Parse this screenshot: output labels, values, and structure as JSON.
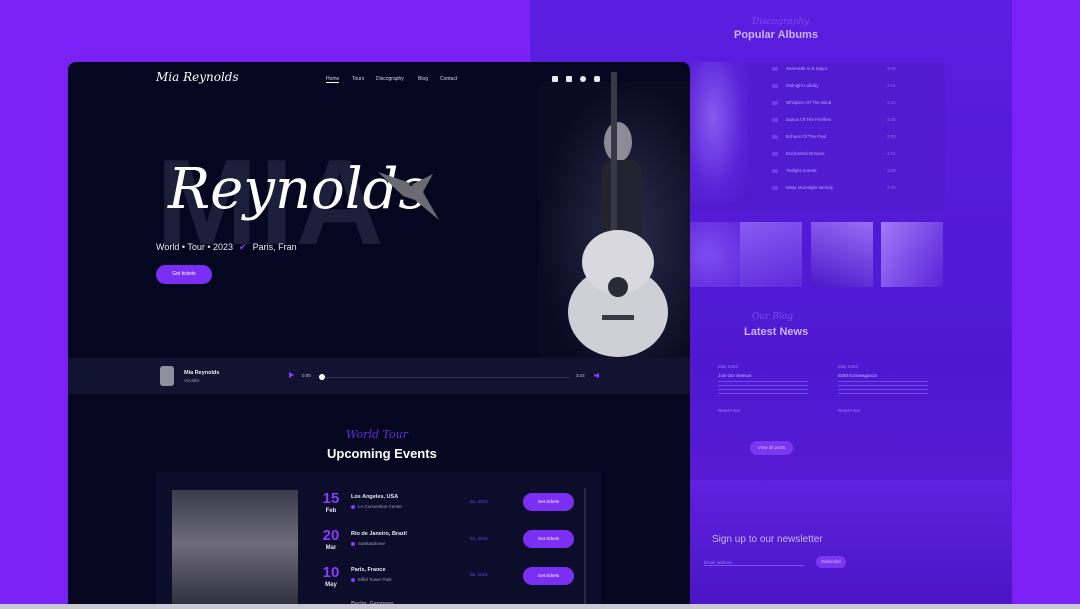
{
  "right": {
    "albums_kicker": "Discography",
    "albums_title": "Popular Albums",
    "tracks": [
      {
        "title": "Serenade In E Major",
        "time": "3:10"
      },
      {
        "title": "Midnight Lullaby",
        "time": "3:21"
      },
      {
        "title": "Whispers Of The Wind",
        "time": "3:14"
      },
      {
        "title": "Dance Of The Fireflies",
        "time": "3:40"
      },
      {
        "title": "Echoes Of The Past",
        "time": "3:05"
      },
      {
        "title": "Enchanted Dreams",
        "time": "4:01"
      },
      {
        "title": "Twilight Sonata",
        "time": "3:29"
      },
      {
        "title": "Misty Moonlight Melody",
        "time": "3:55"
      }
    ],
    "news_kicker": "Our Blog",
    "news_title": "Latest News",
    "news": [
      {
        "date": "May 2023",
        "title": "Join Our Season",
        "link": "Read more"
      },
      {
        "date": "May 2023",
        "title": "EDM Extravaganza",
        "link": "Read more"
      }
    ],
    "news_button": "View all posts",
    "newsletter_title": "Sign up to our newsletter",
    "newsletter_placeholder": "Email address",
    "newsletter_button": "Subscribe"
  },
  "nav": {
    "logo": "Mia Reynolds",
    "links": [
      "Home",
      "Tours",
      "Discography",
      "Blog",
      "Contact"
    ]
  },
  "hero": {
    "big_text": "MIA",
    "script_text": "Reynolds",
    "tour_line": "World • Tour • 2023",
    "location": "Paris, Fran",
    "cta": "Get tickets"
  },
  "player": {
    "artist": "Mia Reynolds",
    "role": "Vocalist",
    "elapsed": "0:00",
    "total": "3:44"
  },
  "events": {
    "kicker": "World Tour",
    "title": "Upcoming Events",
    "items": [
      {
        "day": "15",
        "month": "Feb",
        "city": "Los Angeles, USA",
        "venue": "LA Convention Center",
        "date": "02, 2023",
        "button": "Get tickets"
      },
      {
        "day": "20",
        "month": "Mar",
        "city": "Rio de Janeiro, Brazil",
        "venue": "Sambadrome",
        "date": "03, 2023",
        "button": "Get tickets"
      },
      {
        "day": "10",
        "month": "May",
        "city": "Paris, France",
        "venue": "Eiffel Tower Park",
        "date": "05, 2023",
        "button": "Get tickets"
      },
      {
        "day": "",
        "month": "",
        "city": "Berlin, Germany",
        "venue": "",
        "date": "",
        "button": ""
      }
    ]
  },
  "colors": {
    "background": "#7a22f5",
    "card": "#05061f",
    "accent": "#7b2ff5"
  }
}
